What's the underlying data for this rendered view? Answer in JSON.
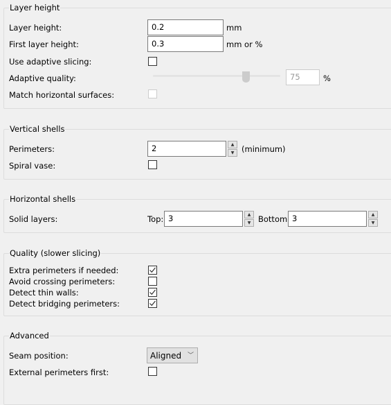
{
  "layer_height": {
    "title": "Layer height",
    "layer_height_label": "Layer height:",
    "layer_height_value": "0.2",
    "layer_height_unit": "mm",
    "first_layer_label": "First layer height:",
    "first_layer_value": "0.3",
    "first_layer_unit": "mm or %",
    "adaptive_label": "Use adaptive slicing:",
    "adaptive_checked": false,
    "quality_label": "Adaptive quality:",
    "quality_value": "75",
    "quality_percent": 75,
    "quality_unit": "%",
    "match_label": "Match horizontal surfaces:",
    "match_checked": false
  },
  "vertical_shells": {
    "title": "Vertical shells",
    "perimeters_label": "Perimeters:",
    "perimeters_value": "2",
    "perimeters_unit": "(minimum)",
    "spiral_label": "Spiral vase:",
    "spiral_checked": false
  },
  "horizontal_shells": {
    "title": "Horizontal shells",
    "solid_label": "Solid layers:",
    "top_label": "Top:",
    "top_value": "3",
    "bottom_label": "Bottom:",
    "bottom_value": "3"
  },
  "quality": {
    "title": "Quality (slower slicing)",
    "items": [
      {
        "label": "Extra perimeters if needed:",
        "checked": true
      },
      {
        "label": "Avoid crossing perimeters:",
        "checked": false
      },
      {
        "label": "Detect thin walls:",
        "checked": true
      },
      {
        "label": "Detect bridging perimeters:",
        "checked": true
      }
    ]
  },
  "advanced": {
    "title": "Advanced",
    "seam_label": "Seam position:",
    "seam_value": "Aligned",
    "external_label": "External perimeters first:",
    "external_checked": false
  }
}
